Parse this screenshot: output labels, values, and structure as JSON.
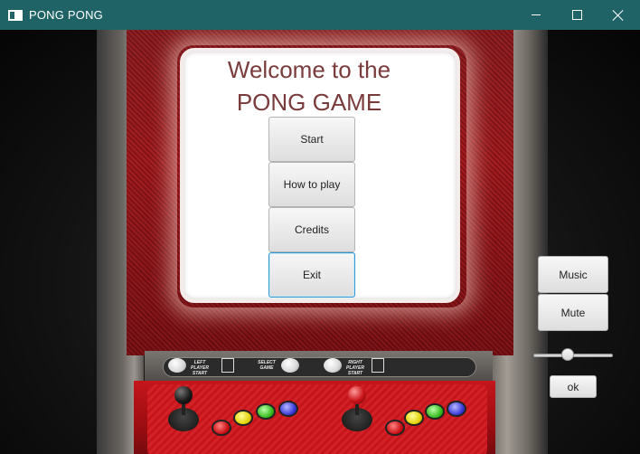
{
  "window": {
    "title": "PONG PONG",
    "title_bar_color": "#1f6366",
    "icons": {
      "app": "app-window-icon",
      "minimize": "minimize-icon",
      "maximize": "maximize-icon",
      "close": "close-icon"
    }
  },
  "screen": {
    "welcome_line1": "Welcome to the",
    "welcome_line2": "PONG GAME",
    "welcome_color": "#7a3b3b"
  },
  "menu": {
    "start_label": "Start",
    "how_to_play_label": "How to play",
    "credits_label": "Credits",
    "exit_label": "Exit",
    "focused": "Exit"
  },
  "controls": {
    "music_label": "Music",
    "mute_label": "Mute",
    "ok_label": "ok",
    "volume_fraction": 0.42
  },
  "panel": {
    "left_start_label": "LEFT PLAYER START",
    "select_game_label": "SELECT GAME",
    "right_start_label": "RIGHT PLAYER START"
  },
  "colors": {
    "cabinet_red": "#a1171b",
    "focus_blue": "#2f9ad6"
  }
}
